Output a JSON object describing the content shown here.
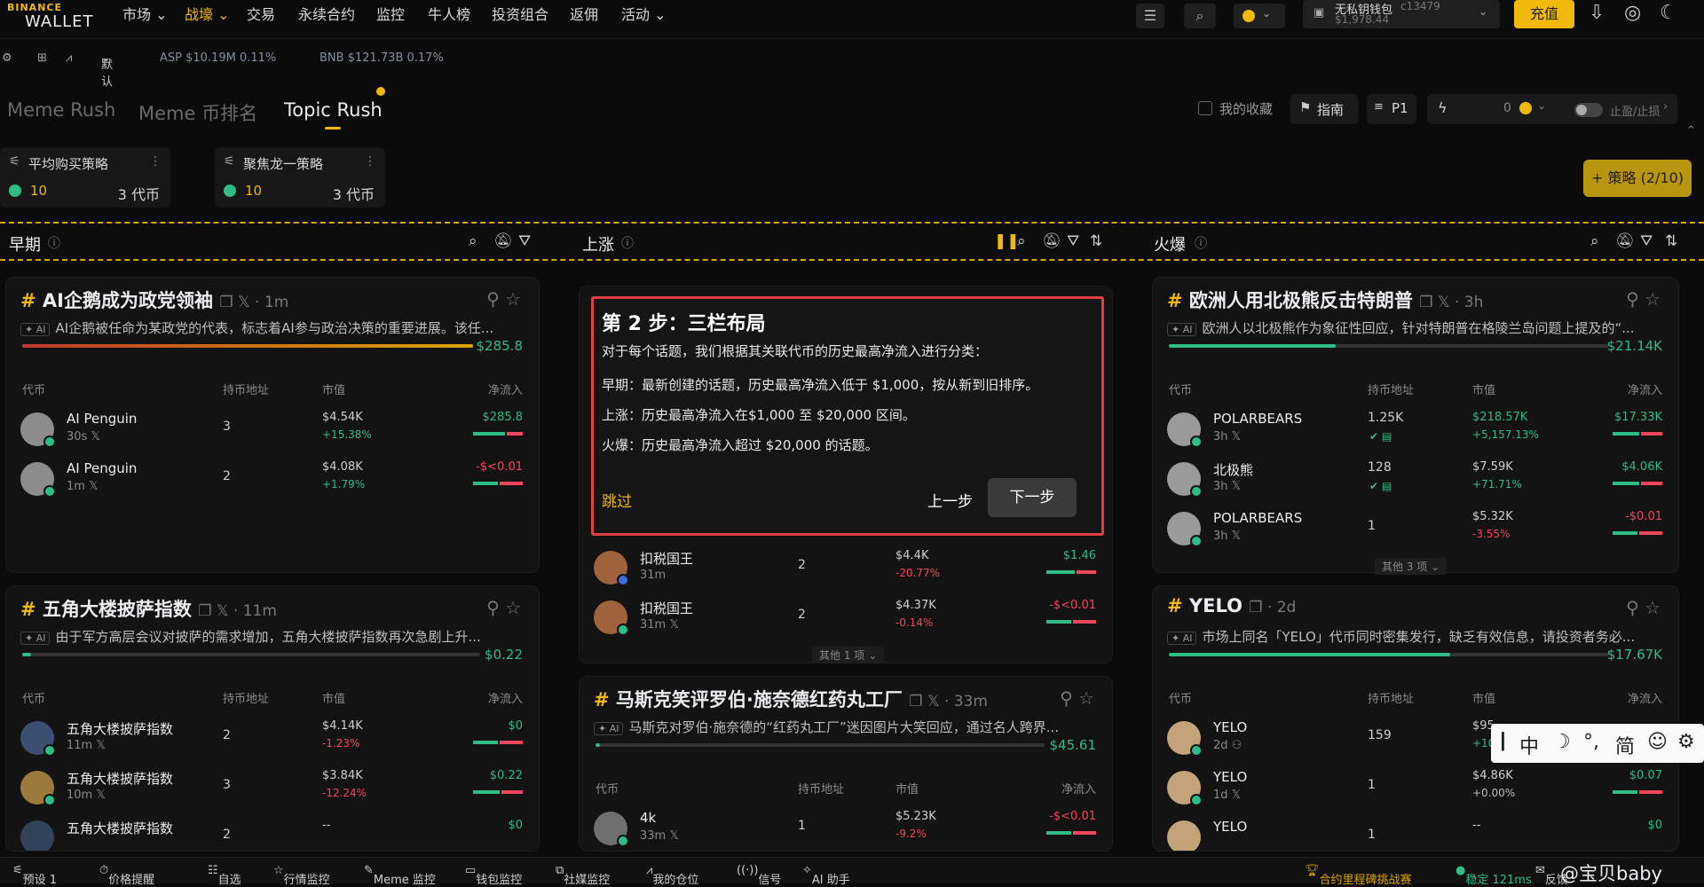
{
  "header": {
    "logo_top": "BINANCE",
    "logo_bottom": "WALLET",
    "nav": [
      "市场",
      "战壕",
      "交易",
      "永续合约",
      "监控",
      "牛人榜",
      "投资组合",
      "返佣",
      "活动"
    ],
    "wallet_name": "无私钥钱包",
    "wallet_id": "c13479",
    "wallet_balance": "$1,978.44",
    "deposit": "充值"
  },
  "subbar": {
    "default": "默认",
    "asp": "ASP $10.19M 0.11%",
    "bnb": "BNB $121.73B 0.17%"
  },
  "tabs": [
    "Meme Rush",
    "Meme 币排名",
    "Topic Rush"
  ],
  "tools": {
    "favorites": "我的收藏",
    "guide": "指南",
    "p1": "P1",
    "zero": "0",
    "tpsl": "止盈/止损"
  },
  "strategies": [
    {
      "name": "平均购买策略",
      "num": "10",
      "count": "3 代币"
    },
    {
      "name": "聚焦龙一策略",
      "num": "10",
      "count": "3 代币"
    }
  ],
  "add_strategy": "+ 策略 (2/10)",
  "columns": {
    "early": "早期",
    "rising": "上涨",
    "hot": "火爆"
  },
  "table_headers": {
    "token": "代币",
    "holders": "持币地址",
    "mcap": "市值",
    "netflow": "净流入"
  },
  "cards": {
    "c1": {
      "title": "AI企鹅成为政党领袖",
      "age": "1m",
      "desc": "AI企鹅被任命为某政党的代表，标志着AI参与政治决策的重要进展。该任...",
      "amount": "$285.8",
      "rows": [
        {
          "name": "AI Penguin",
          "age": "30s",
          "holders": "3",
          "mcap": "$4.54K",
          "pct": "+15.38%",
          "flow": "$285.8"
        },
        {
          "name": "AI Penguin",
          "age": "1m",
          "holders": "2",
          "mcap": "$4.08K",
          "pct": "+1.79%",
          "flow": "-$<0.01"
        }
      ]
    },
    "c2": {
      "title": "五角大楼披萨指数",
      "age": "11m",
      "desc": "由于军方高层会议对披萨的需求增加，五角大楼披萨指数再次急剧上升...",
      "amount": "$0.22",
      "rows": [
        {
          "name": "五角大楼披萨指数",
          "age": "11m",
          "holders": "2",
          "mcap": "$4.14K",
          "pct": "-1.23%",
          "flow": "$0"
        },
        {
          "name": "五角大楼披萨指数",
          "age": "10m",
          "holders": "3",
          "mcap": "$3.84K",
          "pct": "-12.24%",
          "flow": "$0.22"
        },
        {
          "name": "五角大楼披萨指数",
          "age": "",
          "holders": "2",
          "mcap": "--",
          "pct": "",
          "flow": "$0"
        }
      ]
    },
    "c3": {
      "rows": [
        {
          "name": "扣税国王",
          "age": "31m",
          "holders": "2",
          "mcap": "$4.4K",
          "pct": "-20.77%",
          "flow": "$1.46"
        },
        {
          "name": "扣税国王",
          "age": "31m",
          "holders": "2",
          "mcap": "$4.37K",
          "pct": "-0.14%",
          "flow": "-$<0.01"
        }
      ],
      "more": "其他 1 项"
    },
    "c4": {
      "title": "马斯克笑评罗伯·施奈德红药丸工厂",
      "age": "33m",
      "desc": "马斯克对罗伯·施奈德的“红药丸工厂”迷因图片大笑回应，通过名人跨界...",
      "amount": "$45.61",
      "rows": [
        {
          "name": "4k",
          "age": "33m",
          "holders": "1",
          "mcap": "$5.23K",
          "pct": "-9.2%",
          "flow": "-$<0.01"
        }
      ]
    },
    "c5": {
      "title": "欧洲人用北极熊反击特朗普",
      "age": "3h",
      "desc": "欧洲人以北极熊作为象征性回应，针对特朗普在格陵兰岛问题上提及的“...",
      "amount": "$21.14K",
      "rows": [
        {
          "name": "POLARBEARS",
          "age": "3h",
          "holders": "1.25K",
          "mcap": "$218.57K",
          "pct": "+5,157.13%",
          "flow": "$17.33K"
        },
        {
          "name": "北极熊",
          "age": "3h",
          "holders": "128",
          "mcap": "$7.59K",
          "pct": "+71.71%",
          "flow": "$4.06K"
        },
        {
          "name": "POLARBEARS",
          "age": "3h",
          "holders": "1",
          "mcap": "$5.32K",
          "pct": "-3.55%",
          "flow": "-$0.01"
        }
      ],
      "more": "其他 3 项"
    },
    "c6": {
      "title": "YELO",
      "age": "2d",
      "desc": "市场上同名「YELO」代币同时密集发行，缺乏有效信息，请投资者务必...",
      "amount": "$17.67K",
      "rows": [
        {
          "name": "YELO",
          "age": "2d",
          "holders": "159",
          "mcap": "$95",
          "pct": "+10",
          "flow": ""
        },
        {
          "name": "YELO",
          "age": "1d",
          "holders": "1",
          "mcap": "$4.86K",
          "pct": "+0.00%",
          "flow": "$0.07"
        },
        {
          "name": "YELO",
          "age": "",
          "holders": "1",
          "mcap": "--",
          "pct": "",
          "flow": "$0"
        }
      ]
    }
  },
  "tooltip": {
    "title": "第 2 步：三栏布局",
    "intro": "对于每个话题，我们根据其关联代币的历史最高净流入进行分类：",
    "early": "早期：最新创建的话题，历史最高净流入低于 $1,000，按从新到旧排序。",
    "rising": "上涨：历史最高净流入在$1,000 至 $20,000 区间。",
    "hot": "火爆：历史最高净流入超过 $20,000 的话题。",
    "skip": "跳过",
    "prev": "上一步",
    "next": "下一步"
  },
  "bottombar": {
    "preset": "预设 1",
    "price_alert": "价格提醒",
    "watchlist": "自选",
    "market_monitor": "行情监控",
    "meme_monitor": "Meme 监控",
    "wallet_monitor": "钱包监控",
    "social_monitor": "社媒监控",
    "positions": "我的仓位",
    "signal": "信号",
    "ai": "AI 助手",
    "challenge": "合约里程碑挑战赛",
    "status": "稳定 121ms",
    "feedback": "反馈"
  },
  "ime": {
    "zh": "中",
    "simp": "简"
  },
  "watermark": "@宝贝baby",
  "colors": {
    "accent": "#f0b90b",
    "up": "#2ebd85",
    "down": "#f6465d",
    "highlight_border": "#e04040"
  }
}
